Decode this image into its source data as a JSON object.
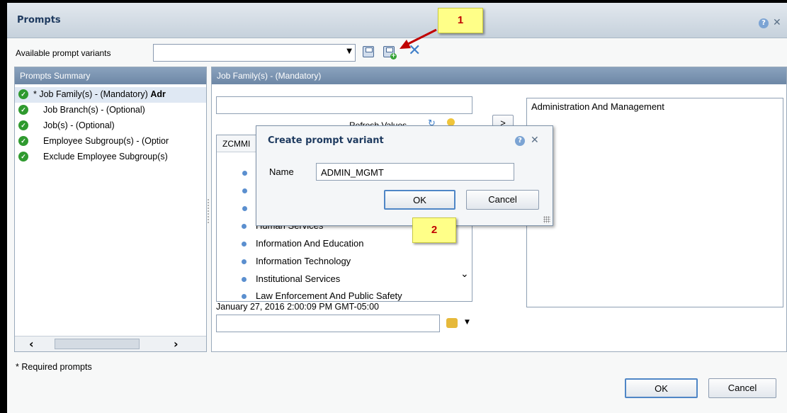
{
  "window": {
    "title": "Prompts"
  },
  "variants": {
    "label": "Available prompt variants",
    "selected": "",
    "icons": [
      "save-icon",
      "save-as-new-icon",
      "delete-icon"
    ]
  },
  "summary": {
    "title": "Prompts Summary",
    "items": [
      {
        "prefix": "* Job Family(s) - (Mandatory)",
        "bold": "Adr"
      },
      {
        "prefix": "Job Branch(s) - (Optional)",
        "bold": ""
      },
      {
        "prefix": "Job(s) - (Optional)",
        "bold": ""
      },
      {
        "prefix": "Employee Subgroup(s) - (Optior",
        "bold": ""
      },
      {
        "prefix": "Exclude Employee Subgroup(s)",
        "bold": ""
      }
    ]
  },
  "job_family": {
    "title": "Job Family(s) - (Mandatory)",
    "search_value": "",
    "refresh_label": "Refresh Values",
    "add_button": ">",
    "column_header": "ZCMMI",
    "values": [
      "Human Services",
      "Information And Education",
      "Information Technology",
      "Institutional Services",
      "Law Enforcement And Public Safety"
    ],
    "timestamp": "January 27, 2016 2:00:09 PM GMT-05:00",
    "bottom_input_value": "",
    "selected_values": [
      "Administration And Management"
    ]
  },
  "dialog": {
    "title": "Create prompt variant",
    "name_label": "Name",
    "name_value": "ADMIN_MGMT",
    "ok_label": "OK",
    "cancel_label": "Cancel"
  },
  "footer": {
    "required_note": "* Required prompts",
    "ok_label": "OK",
    "cancel_label": "Cancel"
  },
  "annotations": {
    "callout_1": "1",
    "callout_2": "2"
  },
  "colors": {
    "accent_red": "#c00000",
    "callout_bg": "#ffff88",
    "header_blue": "#7a93b1"
  }
}
